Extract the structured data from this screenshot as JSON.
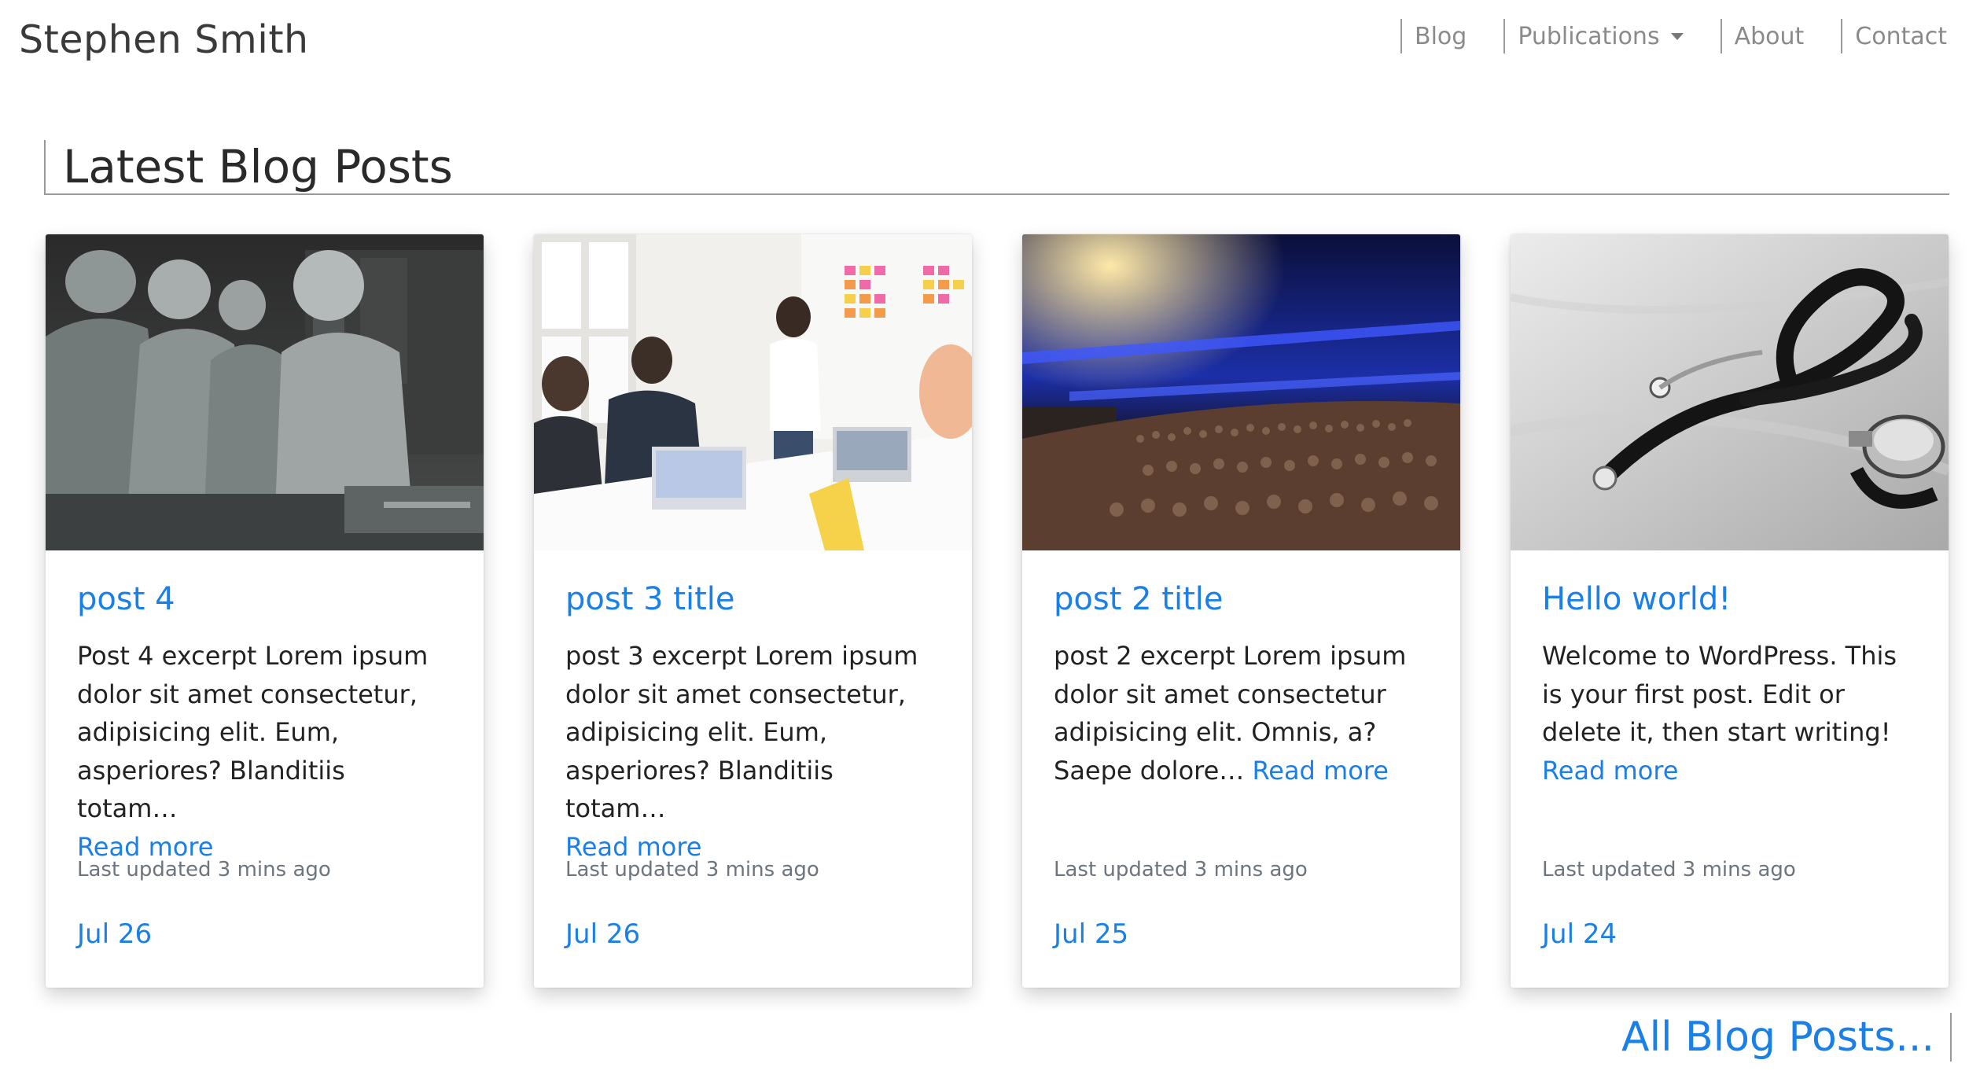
{
  "site": {
    "brand": "Stephen Smith"
  },
  "nav": {
    "items": [
      {
        "label": "Blog"
      },
      {
        "label": "Publications"
      },
      {
        "label": "About"
      },
      {
        "label": "Contact"
      }
    ]
  },
  "section": {
    "title": "Latest Blog Posts"
  },
  "posts": [
    {
      "title": "post 4",
      "excerpt": "Post 4 excerpt Lorem ipsum dolor sit amet consectetur, adipisicing elit. Eum, asperiores? Blanditiis totam…",
      "read_more": "Read more",
      "updated": "Last updated 3 mins ago",
      "date": "Jul 26",
      "image": "surgeons-operating-room"
    },
    {
      "title": "post 3 title",
      "excerpt": "post 3 excerpt Lorem ipsum dolor sit amet consectetur, adipisicing elit. Eum, asperiores? Blanditiis totam…",
      "read_more": "Read more",
      "updated": "Last updated 3 mins ago",
      "date": "Jul 26",
      "image": "office-meeting-whiteboard"
    },
    {
      "title": "post 2 title",
      "excerpt": "post 2 excerpt Lorem ipsum dolor sit amet consectetur adipisicing elit. Omnis, a? Saepe dolore…",
      "read_more": "Read more",
      "updated": "Last updated 3 mins ago",
      "date": "Jul 25",
      "image": "conference-audience-hall"
    },
    {
      "title": "Hello world!",
      "excerpt": "Welcome to WordPress. This is your first post. Edit or delete it, then start writing!",
      "read_more": "Read more",
      "updated": "Last updated 3 mins ago",
      "date": "Jul 24",
      "image": "stethoscope"
    }
  ],
  "footer_link": {
    "label": "All Blog Posts..."
  },
  "colors": {
    "link": "#1a7fe6",
    "text": "#212529",
    "muted": "#6c757d",
    "nav": "#8a8a8a"
  }
}
